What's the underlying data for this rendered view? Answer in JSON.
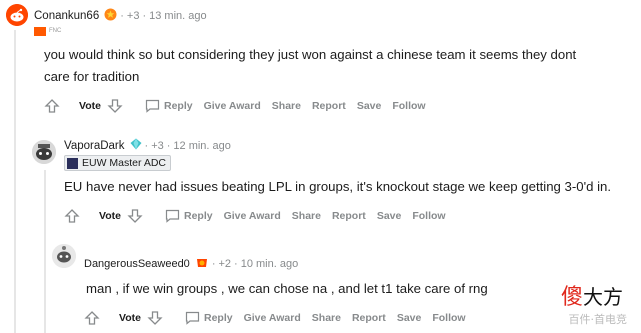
{
  "comments": [
    {
      "username": "Conankun66",
      "points": "+3",
      "time": "13 min. ago",
      "flair_text": "FNC",
      "body": "you would think so but considering they just won against a chinese team it seems they dont care for tradition",
      "actions": {
        "vote": "Vote",
        "reply": "Reply",
        "give_award": "Give Award",
        "share": "Share",
        "report": "Report",
        "save": "Save",
        "follow": "Follow"
      }
    },
    {
      "username": "VaporaDark",
      "points": "+3",
      "time": "12 min. ago",
      "flair_text": "EUW Master ADC",
      "body": "EU have never had issues beating LPL in groups, it's knockout stage we keep getting 3-0'd in.",
      "actions": {
        "vote": "Vote",
        "reply": "Reply",
        "give_award": "Give Award",
        "share": "Share",
        "report": "Report",
        "save": "Save",
        "follow": "Follow"
      }
    },
    {
      "username": "DangerousSeaweed0",
      "points": "+2",
      "time": "10 min. ago",
      "body": "man , if we win groups , we can chose na , and let t1 take care of rng",
      "actions": {
        "vote": "Vote",
        "reply": "Reply",
        "give_award": "Give Award",
        "share": "Share",
        "report": "Report",
        "save": "Save",
        "follow": "Follow"
      }
    }
  ],
  "watermark": {
    "text_accent": "傻",
    "text_main": "大方",
    "subtext": "百件·首电竞"
  },
  "colors": {
    "meta_gray": "#878a8c",
    "thread_line": "#e6e6e6",
    "text": "#1c1c1c",
    "accent_orange": "#ff4500"
  }
}
